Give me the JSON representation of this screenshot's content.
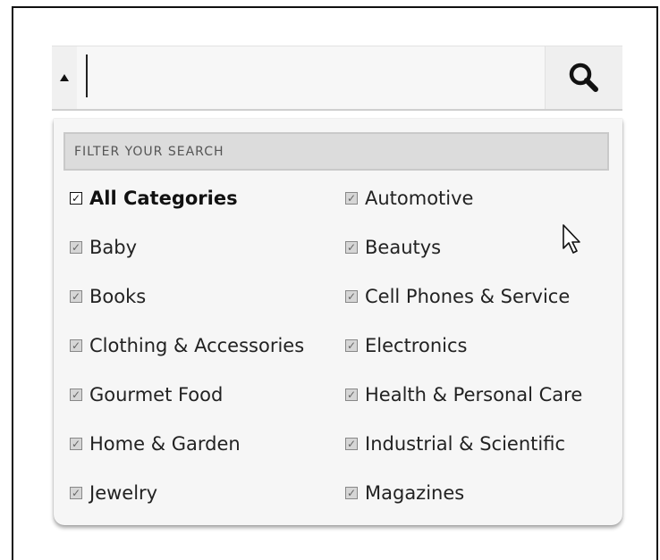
{
  "search": {
    "value": "",
    "placeholder": "",
    "toggle_icon": "triangle-up-icon",
    "button_icon": "magnifier-icon"
  },
  "filter": {
    "header": "FILTER YOUR SEARCH",
    "categories": [
      {
        "label": "All Categories",
        "checked": true,
        "bold": true
      },
      {
        "label": "Automotive",
        "checked": true
      },
      {
        "label": "Baby",
        "checked": true
      },
      {
        "label": "Beautys",
        "checked": true
      },
      {
        "label": "Books",
        "checked": true
      },
      {
        "label": "Cell Phones & Service",
        "checked": true
      },
      {
        "label": "Clothing & Accessories",
        "checked": true
      },
      {
        "label": "Electronics",
        "checked": true
      },
      {
        "label": "Gourmet Food",
        "checked": true
      },
      {
        "label": "Health & Personal Care",
        "checked": true
      },
      {
        "label": "Home & Garden",
        "checked": true
      },
      {
        "label": "Industrial & Scientific",
        "checked": true
      },
      {
        "label": "Jewelry",
        "checked": true
      },
      {
        "label": "Magazines",
        "checked": true
      }
    ]
  },
  "colors": {
    "panel": "#f6f6f6",
    "header_bg": "#dcdcdc",
    "text": "#222222",
    "checkbox_disabled": "#d6d6d6"
  }
}
